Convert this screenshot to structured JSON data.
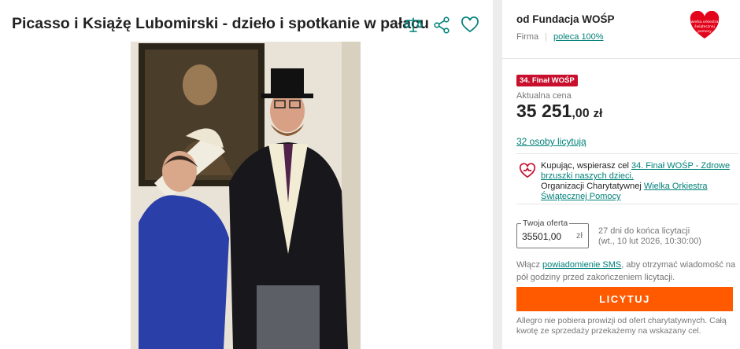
{
  "listing": {
    "title": "Picasso i Książę Lubomirski - dzieło i spotkanie w pałacu",
    "icons": [
      "compare-icon",
      "share-icon",
      "heart-icon"
    ]
  },
  "seller": {
    "name": "od Fundacja WOŚP",
    "type": "Firma",
    "recommend": "poleca 100%",
    "logo_text": "wielka orkiestra świątecznej pomocy"
  },
  "auction": {
    "badge": "34. Finał WOŚP",
    "price_label": "Aktualna cena",
    "price_main": "35 251",
    "price_decimal": ",00",
    "currency": "zł",
    "bidders": "32 osoby licytują"
  },
  "charity": {
    "line1": "Kupując, wspierasz cel ",
    "cause_link": "34. Finał WOŚP - Zdrowe brzuszki naszych dzieci.",
    "line2": "Organizacji Charytatywnej ",
    "org_link": "Wielka Orkiestra Świątecznej Pomocy"
  },
  "offer": {
    "label": "Twoja oferta",
    "value": "35501,00",
    "currency": "zł",
    "deadline1": "27 dni do końca licytacji",
    "deadline2": "(wt., 10 lut 2026, 10:30:00)"
  },
  "sms": {
    "prefix": "Włącz ",
    "link": "powiadomienie SMS",
    "suffix": ", aby otrzymać wiadomość na pół godziny przed zakończeniem licytacji."
  },
  "bid_button": "LICYTUJ",
  "note": "Allegro nie pobiera prowizji od ofert charytatywnych. Całą kwotę ze sprzedaży przekażemy na wskazany cel.",
  "colors": {
    "accent": "#ff5a00",
    "link": "#00817a",
    "badge": "#c8102e"
  }
}
